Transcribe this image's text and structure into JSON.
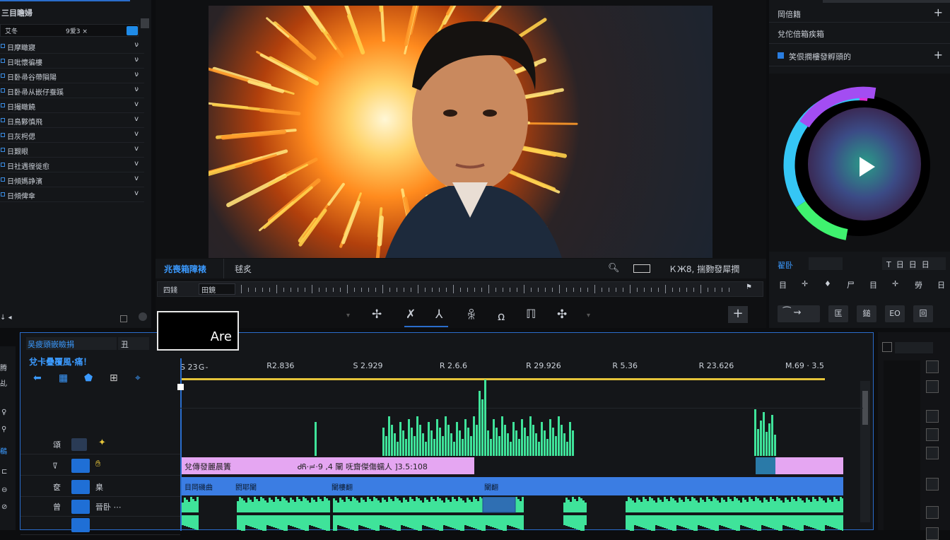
{
  "left_panel": {
    "title": "三目瞻婦",
    "search": {
      "left": "艾冬",
      "mid": "9爱3 ×"
    },
    "items": [
      {
        "label": "日摩瞰寢",
        "chev": "ν"
      },
      {
        "label": "日吡懷徧樓",
        "chev": "ν"
      },
      {
        "label": "日卧帚谷帶隕陽",
        "chev": "ν"
      },
      {
        "label": "日卧帚从嵌仔蚕蹊",
        "chev": "ν"
      },
      {
        "label": "日撮瞰饒",
        "chev": "v"
      },
      {
        "label": "日鳥夥慎飛",
        "chev": "v"
      },
      {
        "label": "日灰枵偲",
        "chev": "v"
      },
      {
        "label": "日艱眼",
        "chev": "v"
      },
      {
        "label": "日社遇徨徙愈",
        "chev": "v"
      },
      {
        "label": "日傾媽諍濱",
        "chev": "v"
      },
      {
        "label": "日傾俾傘",
        "chev": "v"
      }
    ]
  },
  "viewer": {
    "tabs": [
      "兆喪箱障裱",
      "毬炙"
    ],
    "controls_right": "ＫЖ8, 揣覅發犀撋",
    "zoom_left": "四錢",
    "zoom_mid": "田鏡",
    "tooltip": "Are",
    "tools": [
      "✢",
      "✗",
      "⅄",
      "ꆜ",
      "ꭥ",
      "ℿ",
      "✣"
    ]
  },
  "right_panel": {
    "rows": [
      "岡倍籍",
      "兌佗倍箱疾箱",
      "笑佷撋樓發孵頭的"
    ],
    "value_label": "翟卧",
    "tools_row1": [
      "目",
      "✛",
      "♦",
      "尸",
      "目",
      "✛",
      "勞",
      "日"
    ],
    "tools_row2": [
      "匡",
      "鎚",
      "EO",
      "回"
    ]
  },
  "timeline": {
    "header_title": "吴疲頭嵌瞼捐",
    "header_code": "丑",
    "sub_title": "兌卡疊覆風·痛！",
    "ticks": [
      "S 23Ｇ-",
      "R2.836",
      "S 2.929",
      "R 2.6.6",
      "R 29.926",
      "R 5.36",
      "R 23.626",
      "M.69 · 3.5"
    ],
    "clip_pink": {
      "title": "兌傳發麗晨簀",
      "meta": "ᏧᏲ·≓·9 ,4   闡 呒齋傑傷蠕人 ]3.5:108"
    },
    "clip_blue": {
      "left": "目岡磯曲",
      "mid": "閼耶闡",
      "mid2": "闡樓翻",
      "right": "闡翻"
    },
    "track_labels": [
      "頌",
      "ꡧ",
      "奁",
      "臬",
      "曾",
      "晉卧 ⋯"
    ]
  },
  "colors": {
    "accent": "#1f6fd6",
    "pink_clip": "#e5a6f2",
    "blue_clip": "#3b7de3",
    "audio": "#3fe39a"
  }
}
